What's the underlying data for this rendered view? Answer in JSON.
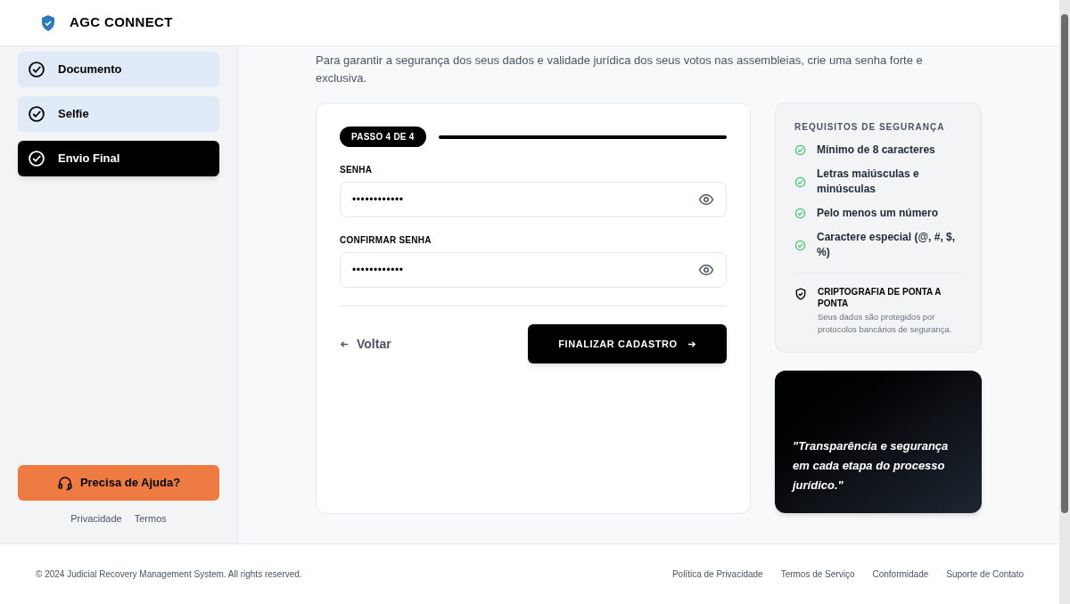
{
  "header": {
    "brand": "AGC CONNECT"
  },
  "sidebar": {
    "steps": [
      {
        "label": "Documento",
        "selected": false
      },
      {
        "label": "Selfie",
        "selected": false
      },
      {
        "label": "Envio Final",
        "selected": true
      }
    ],
    "help_button": "Precisa de Ajuda?",
    "links": [
      "Privacidade",
      "Termos"
    ]
  },
  "intro": "Para garantir a segurança dos seus dados e validade jurídica dos seus votos nas assembleias, crie uma senha forte e exclusiva.",
  "form": {
    "step_badge": "PASSO 4 DE 4",
    "progress": {
      "level": 1
    },
    "fields": [
      {
        "label": "SENHA",
        "value": "••••••••••••"
      },
      {
        "label": "CONFIRMAR SENHA",
        "value": "••••••••••••"
      }
    ],
    "back": "Voltar",
    "submit": "FINALIZAR CADASTRO"
  },
  "requirements": {
    "title": "REQUISITOS DE SEGURANÇA",
    "items": [
      {
        "text": "Mínimo de 8 caracteres",
        "met": true
      },
      {
        "text": "Letras maiúsculas e minúsculas",
        "met": true
      },
      {
        "text": "Pelo menos um número",
        "met": true
      },
      {
        "text": "Caractere especial (@, #, $, %)",
        "met": true
      }
    ],
    "security_title": "CRIPTOGRAFIA DE PONTA A PONTA",
    "security_text": "Seus dados são protegidos por protocolos bancários de segurança."
  },
  "quote": "\"Transparência e segurança em cada etapa do processo jurídico.\"",
  "footer": {
    "copyright": "© 2024 Judicial Recovery Management System. All rights reserved.",
    "links": [
      "Política de Privacidade",
      "Termos de Serviço",
      "Conformidade",
      "Suporte de Contato"
    ]
  }
}
